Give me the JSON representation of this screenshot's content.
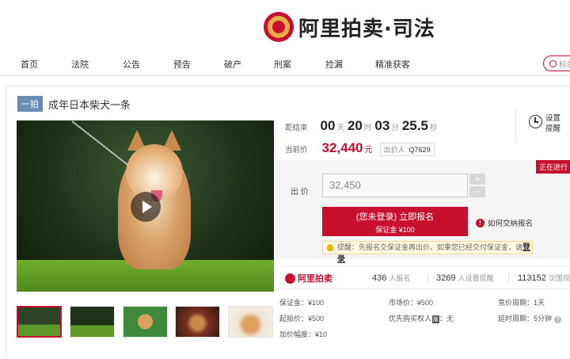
{
  "header": {
    "logo_text": "阿里拍卖·司法",
    "nav": [
      "首页",
      "法院",
      "公告",
      "预告",
      "破产",
      "刑案",
      "捡漏",
      "精准获客"
    ],
    "search_placeholder": "标的"
  },
  "item": {
    "badge": "一拍",
    "title": "成年日本柴犬一条"
  },
  "countdown": {
    "label": "距结束",
    "days": "00",
    "days_unit": "天",
    "hours": "20",
    "hours_unit": "时",
    "minutes": "03",
    "minutes_unit": "分",
    "seconds": "25.5",
    "seconds_unit": "秒"
  },
  "price": {
    "label": "当前价",
    "value": "32,440",
    "unit": "元",
    "bidder_label": "出价人",
    "bidder_id": "Q7629"
  },
  "reminder": {
    "label": "设置提醒"
  },
  "bid": {
    "status": "正在进行",
    "label": "出 价",
    "input_value": "32,450",
    "plus": "+",
    "minus": "−",
    "signup_line1": "(您未登录) 立即报名",
    "signup_line2": "保证金 ¥100",
    "deposit_help": "如何交纳报名",
    "tip_text": "提醒：先报名交保证金再出价。如果您已经交付保证金，请",
    "tip_login": "登录"
  },
  "stats": {
    "brand": "阿里拍卖",
    "signups": "436",
    "signups_label": "人报名",
    "reminders": "3269",
    "reminders_label": "人设置提醒",
    "views": "113152",
    "views_label": "次围观"
  },
  "details": {
    "deposit": "保证金：¥100",
    "market_price": "市场价：¥500",
    "bid_cycle": "竞价周期：1天",
    "start_price": "起拍价：¥500",
    "priority_label": "优先购买权人",
    "priority_tag": "版",
    "priority_value": "：无",
    "delay_cycle": "延时周期：5分钟",
    "increment": "加价幅度：¥10"
  },
  "colors": {
    "accent": "#c8102e",
    "badge": "#6b8cb5",
    "grass": "#5e9b26"
  }
}
